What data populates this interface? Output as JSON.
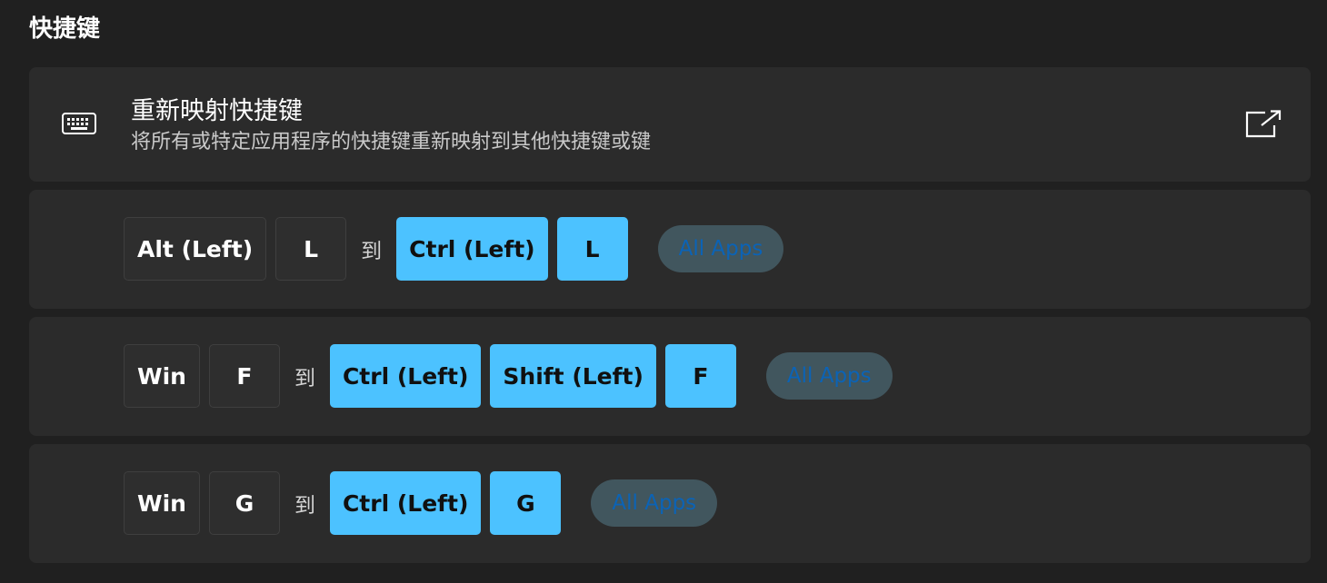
{
  "section": {
    "title": "快捷键"
  },
  "header_card": {
    "icon": "keyboard-icon",
    "title": "重新映射快捷键",
    "subtitle": "将所有或特定应用程序的快捷键重新映射到其他快捷键或键",
    "action_icon": "open-external-icon"
  },
  "separator_label": "到",
  "colors": {
    "background": "#202020",
    "card": "#2b2b2b",
    "source_key": "#2e2e2e",
    "target_key": "#4cc2ff",
    "app_badge": "#41565e",
    "app_badge_text": "#0b63b6"
  },
  "mappings": [
    {
      "source_keys": [
        "Alt (Left)",
        "L"
      ],
      "target_keys": [
        "Ctrl (Left)",
        "L"
      ],
      "app": "All Apps"
    },
    {
      "source_keys": [
        "Win",
        "F"
      ],
      "target_keys": [
        "Ctrl (Left)",
        "Shift (Left)",
        "F"
      ],
      "app": "All Apps"
    },
    {
      "source_keys": [
        "Win",
        "G"
      ],
      "target_keys": [
        "Ctrl (Left)",
        "G"
      ],
      "app": "All Apps"
    }
  ]
}
